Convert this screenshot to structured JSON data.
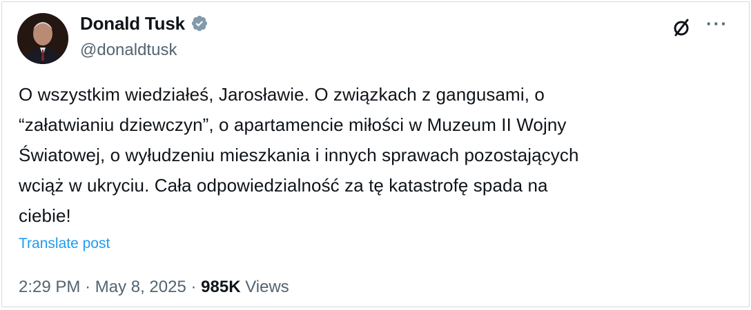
{
  "author": {
    "name": "Donald Tusk",
    "handle": "@donaldtusk",
    "verified_color": "#829aab"
  },
  "actions": {
    "grok_icon": "grok-slash-circle-icon",
    "more_icon": "ellipsis-icon",
    "more_label": "···"
  },
  "tweet": {
    "lines": [
      "O wszystkim wiedziałeś, Jarosławie. O związkach z gangusami, o",
      "“załatwianiu dziewczyn”, o apartamencie miłości w Muzeum II Wojny",
      "Światowej, o wyłudzeniu mieszkania i innych sprawach pozostających",
      "wciąż w ukryciu. Cała odpowiedzialność za tę katastrofę spada na",
      "ciebie!"
    ],
    "translate_label": "Translate post"
  },
  "meta": {
    "time": "2:29 PM",
    "separator": "·",
    "date": "May 8, 2025",
    "views_count": "985K",
    "views_label": "Views"
  },
  "colors": {
    "link": "#1d9bf0",
    "secondary_text": "#536471",
    "primary_text": "#0f1419",
    "border": "#cfd9de"
  }
}
